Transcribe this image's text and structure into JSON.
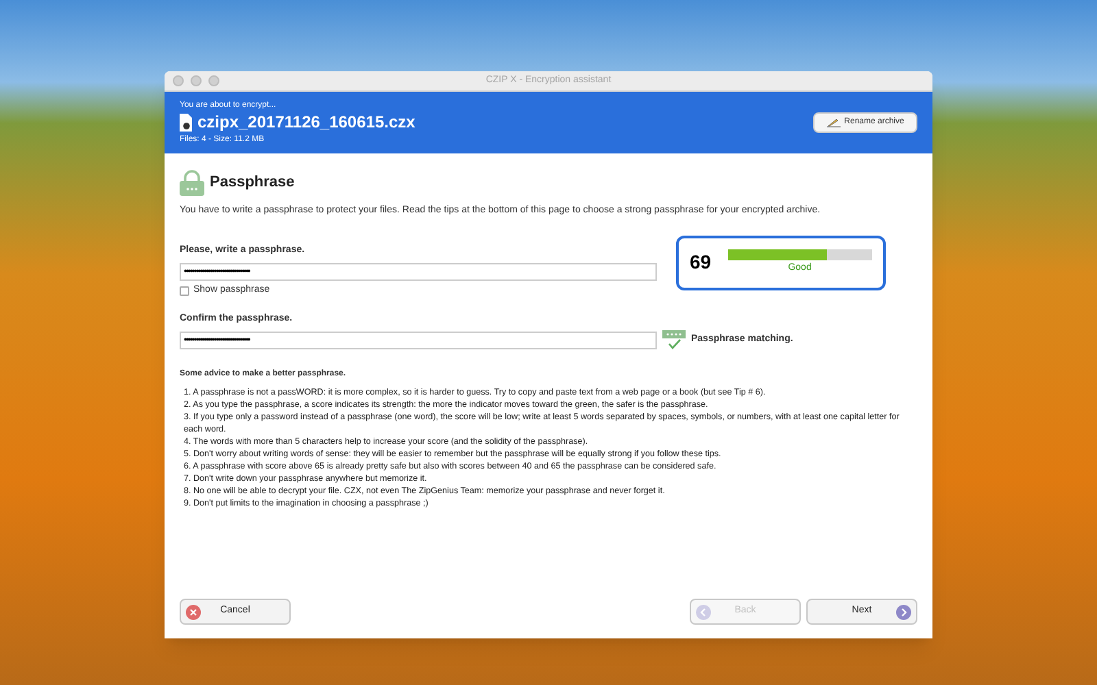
{
  "window": {
    "title": "CZIP X - Encryption assistant"
  },
  "header": {
    "intro": "You are about to encrypt...",
    "filename": "czipx_20171126_160615.czx",
    "details": "Files: 4 - Size: 11.2 MB",
    "rename_button": "Rename archive"
  },
  "section": {
    "title": "Passphrase",
    "description": "You have to write a passphrase to protect your files. Read the tips at the bottom of this page to choose a strong passphrase for your encrypted archive."
  },
  "passphrase": {
    "label": "Please, write a passphrase.",
    "value": "•••••••••••••••••••••••••••••••••",
    "show_checkbox": {
      "label": "Show passphrase",
      "checked": false
    }
  },
  "strength": {
    "score": "69",
    "level": 0.69,
    "rating": "Good"
  },
  "confirm": {
    "label": "Confirm the passphrase.",
    "value": "•••••••••••••••••••••••••••••••••",
    "status": "Passphrase matching."
  },
  "advice": {
    "title": "Some advice to make a better passphrase.",
    "items": [
      "1. A passphrase is not a passWORD: it is more complex, so it is harder to guess. Try to copy and paste text from a web page or a book (but see Tip # 6).",
      "2. As you type the passphrase, a score indicates its strength: the more the indicator moves toward the green, the safer is the passphrase.",
      "3. If you type only a password instead of a passphrase (one word), the score will be low; write at least 5 words separated by spaces, symbols, or numbers, with at least one capital letter for each word.",
      "4. The words with more than 5 characters help to increase your score (and the solidity of the passphrase).",
      "5. Don't worry about writing words of sense: they will be easier to remember but the passphrase will be equally strong if you follow these tips.",
      "6. A passphrase with score above 65 is already pretty safe but also with scores between 40 and 65 the passphrase can be considered safe.",
      "7. Don't write down your passphrase anywhere but memorize it.",
      "8. No one will be able to decrypt your file. CZX, not even The ZipGenius Team: memorize your passphrase and never forget it.",
      "9. Don't put limits to the imagination in choosing a passphrase ;)"
    ]
  },
  "buttons": {
    "cancel": {
      "label": "Cancel",
      "disabled": false
    },
    "back": {
      "label": "Back",
      "disabled": true
    },
    "next": {
      "label": "Next",
      "disabled": false
    }
  }
}
